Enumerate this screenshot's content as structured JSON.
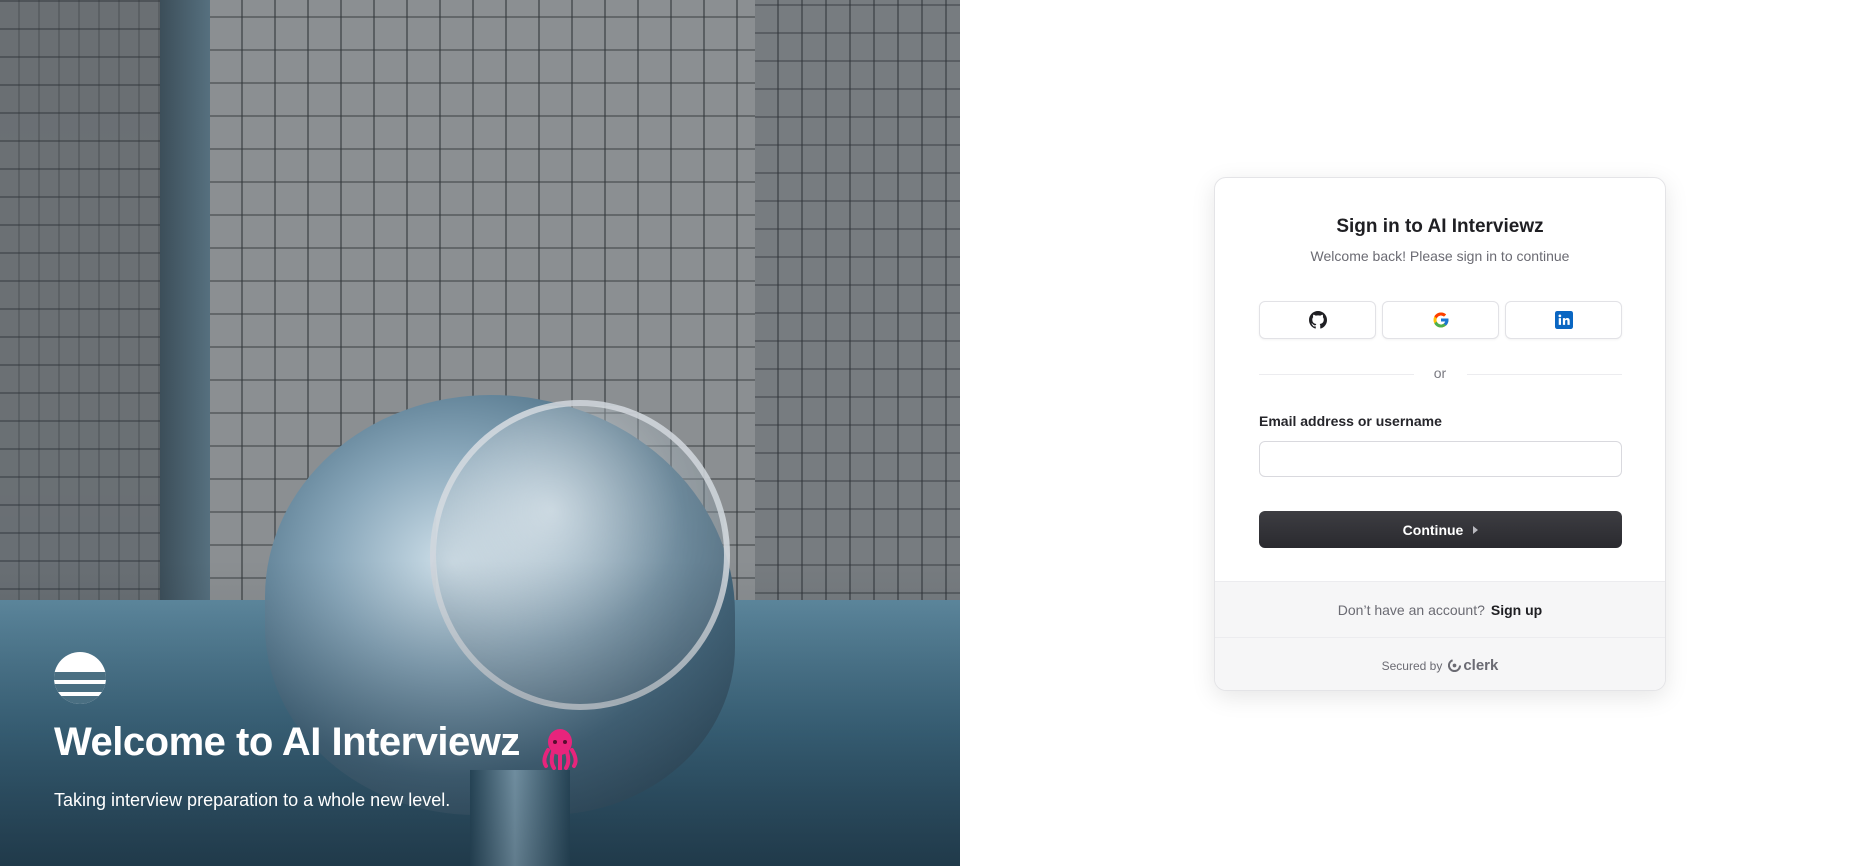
{
  "hero": {
    "title": "Welcome to AI Interviewz",
    "subtitle": "Taking interview preparation to a whole new level.",
    "logo_icon": "waves-logo-icon",
    "emoji_icon": "octopus-icon",
    "emoji_color": "#e8247c"
  },
  "signin": {
    "title": "Sign in to AI Interviewz",
    "subtitle": "Welcome back! Please sign in to continue",
    "social": [
      {
        "name": "github-icon"
      },
      {
        "name": "google-icon"
      },
      {
        "name": "linkedin-icon"
      }
    ],
    "divider": "or",
    "field_label": "Email address or username",
    "field_value": "",
    "continue_label": "Continue",
    "footer_question": "Don’t have an account?",
    "footer_link": "Sign up",
    "secured_by": "Secured by",
    "provider": "clerk"
  },
  "colors": {
    "button_bg": "#2f2f34",
    "linkedin": "#0a66c2",
    "accent_pink": "#e8247c"
  }
}
